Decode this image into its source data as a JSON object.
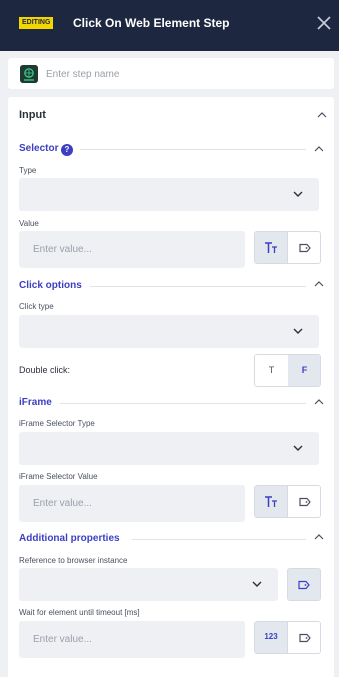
{
  "header": {
    "badge": "EDITING",
    "title": "Click On Web Element Step"
  },
  "step_name": {
    "placeholder": "Enter step name",
    "value": ""
  },
  "input_section": {
    "title": "Input"
  },
  "selector": {
    "title": "Selector",
    "help": "?",
    "type_label": "Type",
    "type_value": "",
    "value_label": "Value",
    "value_placeholder": "Enter value..."
  },
  "click_options": {
    "title": "Click options",
    "click_type_label": "Click type",
    "click_type_value": "",
    "double_click_label": "Double click:",
    "toggle_true": "T",
    "toggle_false": "F",
    "selected": "F"
  },
  "iframe": {
    "title": "iFrame",
    "type_label": "iFrame Selector Type",
    "type_value": "",
    "value_label": "iFrame Selector Value",
    "value_placeholder": "Enter value..."
  },
  "additional": {
    "title": "Additional properties",
    "browser_label": "Reference to browser instance",
    "browser_value": "",
    "timeout_label": "Wait for element until timeout [ms]",
    "timeout_placeholder": "Enter value...",
    "number_mode_label": "123"
  },
  "colors": {
    "header_bg": "#1e2740",
    "badge": "#f2d600",
    "accent": "#3c3fc2"
  },
  "icons": [
    "close-icon",
    "step-type-icon",
    "chevron-up-icon",
    "chevron-down-icon",
    "help-icon",
    "text-type-icon",
    "tag-variable-icon",
    "number-type-icon"
  ]
}
